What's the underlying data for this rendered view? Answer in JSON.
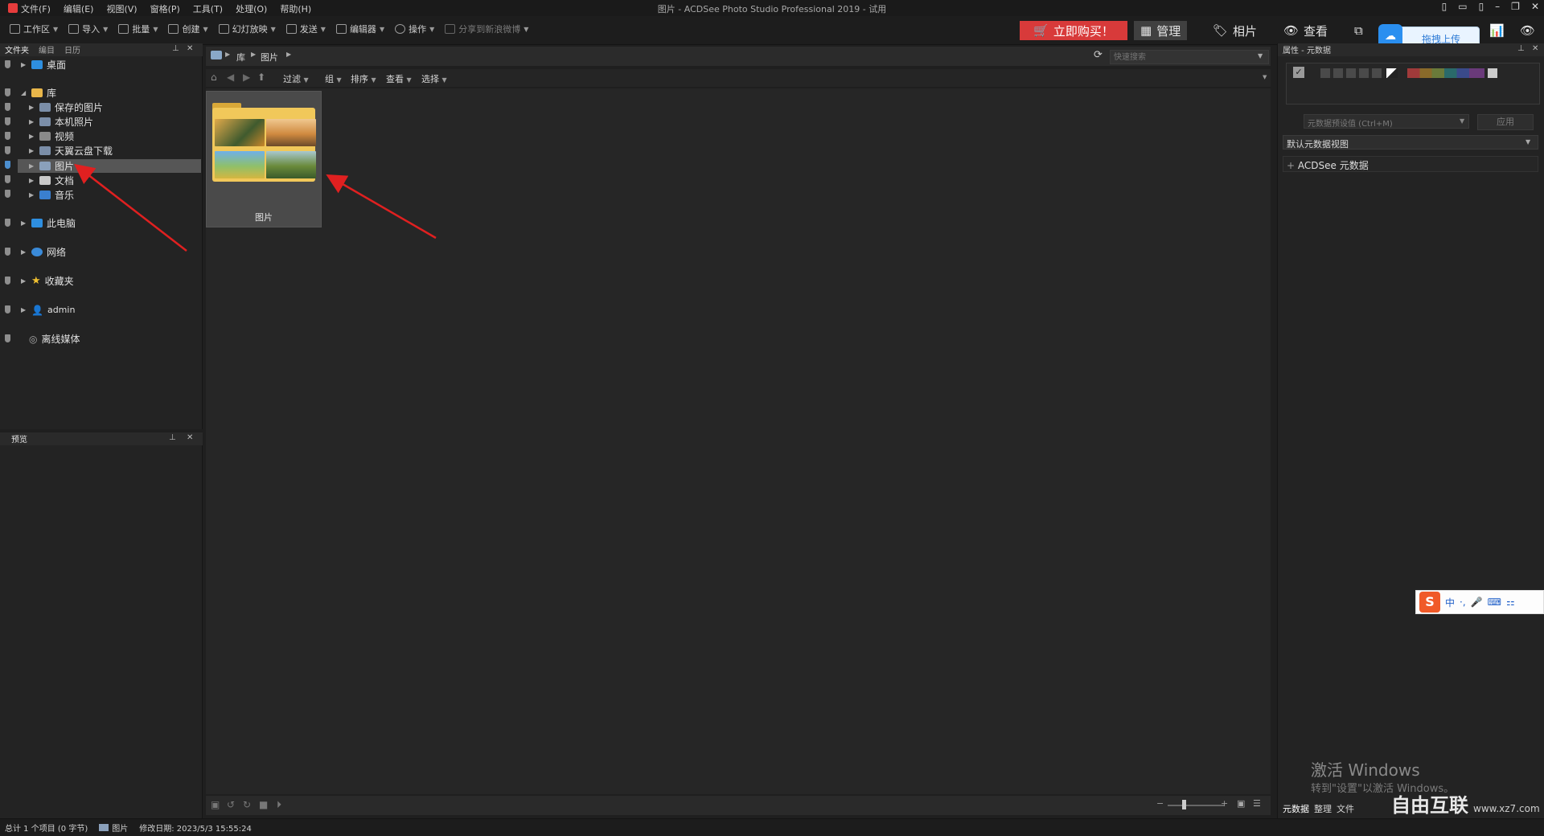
{
  "window": {
    "title": "图片 - ACDSee Photo Studio Professional 2019 - 试用",
    "menu": [
      "文件(F)",
      "编辑(E)",
      "视图(V)",
      "窗格(P)",
      "工具(T)",
      "处理(O)",
      "帮助(H)"
    ]
  },
  "toolbar": {
    "items": [
      "工作区",
      "导入",
      "批量",
      "创建",
      "幻灯放映",
      "发送",
      "编辑器",
      "操作",
      "分享到新浪微博"
    ],
    "buy_now": "立即购买！",
    "modes": [
      "管理",
      "相片",
      "查看"
    ],
    "upload": "拖拽上传"
  },
  "left_panel": {
    "tabs": [
      "文件夹",
      "编目",
      "日历"
    ],
    "tree": [
      {
        "label": "桌面",
        "level": 0
      },
      {
        "label": "库",
        "level": 0
      },
      {
        "label": "保存的图片",
        "level": 1
      },
      {
        "label": "本机照片",
        "level": 1
      },
      {
        "label": "视频",
        "level": 1
      },
      {
        "label": "天翼云盘下载",
        "level": 1
      },
      {
        "label": "图片",
        "level": 1,
        "selected": true
      },
      {
        "label": "文档",
        "level": 1
      },
      {
        "label": "音乐",
        "level": 1
      },
      {
        "label": "此电脑",
        "level": 0
      },
      {
        "label": "网络",
        "level": 0
      },
      {
        "label": "收藏夹",
        "level": 0
      },
      {
        "label": "admin",
        "level": 0
      },
      {
        "label": "离线媒体",
        "level": 0
      }
    ],
    "preview_tab": "预览"
  },
  "browser": {
    "breadcrumb": [
      "库",
      "图片"
    ],
    "search_placeholder": "快速搜索",
    "filter_menus": [
      "过滤",
      "组",
      "排序",
      "查看",
      "选择"
    ],
    "items": [
      {
        "label": "图片",
        "type": "folder"
      }
    ]
  },
  "right_panel": {
    "title": "属性 - 元数据",
    "metadata_preset": "元数据预设值 (Ctrl+M)",
    "apply": "应用",
    "view": "默认元数据视图",
    "section": "ACDSee 元数据",
    "bottom_tabs": [
      "元数据",
      "整理",
      "文件"
    ]
  },
  "status": {
    "total": "总计 1 个项目 (0 字节)",
    "current": "图片",
    "modified": "修改日期: 2023/5/3 15:55:24"
  },
  "watermark": {
    "line1": "激活 Windows",
    "line2": "转到\"设置\"以激活 Windows。"
  },
  "logo": {
    "name": "自由互联",
    "url": "www.xz7.com"
  },
  "ime": [
    "中",
    "·,",
    "🎤",
    "⌨",
    "⚏"
  ]
}
